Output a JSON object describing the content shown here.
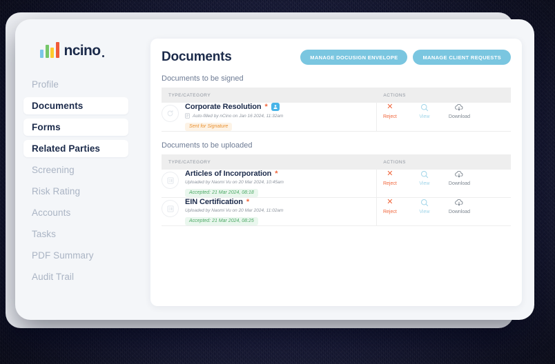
{
  "brand": {
    "logo_word": "ncino",
    "logo_bar_colors": [
      "#7cc6e8",
      "#76c76a",
      "#fecb2e",
      "#f05a38"
    ]
  },
  "sidebar": {
    "items": [
      {
        "label": "Profile",
        "active": false
      },
      {
        "label": "Documents",
        "active": true
      },
      {
        "label": "Forms",
        "active": true
      },
      {
        "label": "Related Parties",
        "active": true
      },
      {
        "label": "Screening",
        "active": false
      },
      {
        "label": "Risk Rating",
        "active": false
      },
      {
        "label": "Accounts",
        "active": false
      },
      {
        "label": "Tasks",
        "active": false
      },
      {
        "label": "PDF Summary",
        "active": false
      },
      {
        "label": "Audit Trail",
        "active": false
      }
    ]
  },
  "header": {
    "title": "Documents",
    "buttons": [
      {
        "label": "MANAGE DOCUSIGN ENVELOPE"
      },
      {
        "label": "MANAGE CLIENT REQUESTS"
      }
    ]
  },
  "table_headers": {
    "type": "TYPE/CATEGORY",
    "actions": "ACTIONS"
  },
  "actions": {
    "reject": "Reject",
    "view": "View",
    "download": "Download"
  },
  "sections": [
    {
      "label": "Documents to be signed",
      "rows": [
        {
          "title": "Corporate Resolution",
          "required_marker": "*",
          "has_signer_badge": true,
          "meta": "Auto-filled by nCino on Jan 16 2024, 11:32am",
          "status": "Sent for Signature",
          "status_type": "sent"
        }
      ]
    },
    {
      "label": "Documents to be uploaded",
      "rows": [
        {
          "title": "Articles of Incorporation",
          "required_marker": "*",
          "has_signer_badge": false,
          "meta": "Uploaded by Naomi Vu on 20 Mar 2024, 10:45am",
          "status": "Accepted: 21 Mar 2024, 08:18",
          "status_type": "accepted"
        },
        {
          "title": "EIN Certification",
          "required_marker": "*",
          "has_signer_badge": false,
          "meta": "Uploaded by Naomi Vu on 20 Mar 2024, 11:02am",
          "status": "Accepted: 21 Mar 2024, 08:25",
          "status_type": "accepted"
        }
      ]
    }
  ],
  "colors": {
    "accent_blue": "#7ac6e0",
    "navy": "#1b2a4a",
    "orange": "#f0663c",
    "green": "#4aa863",
    "backdrop": "#0d1030"
  }
}
